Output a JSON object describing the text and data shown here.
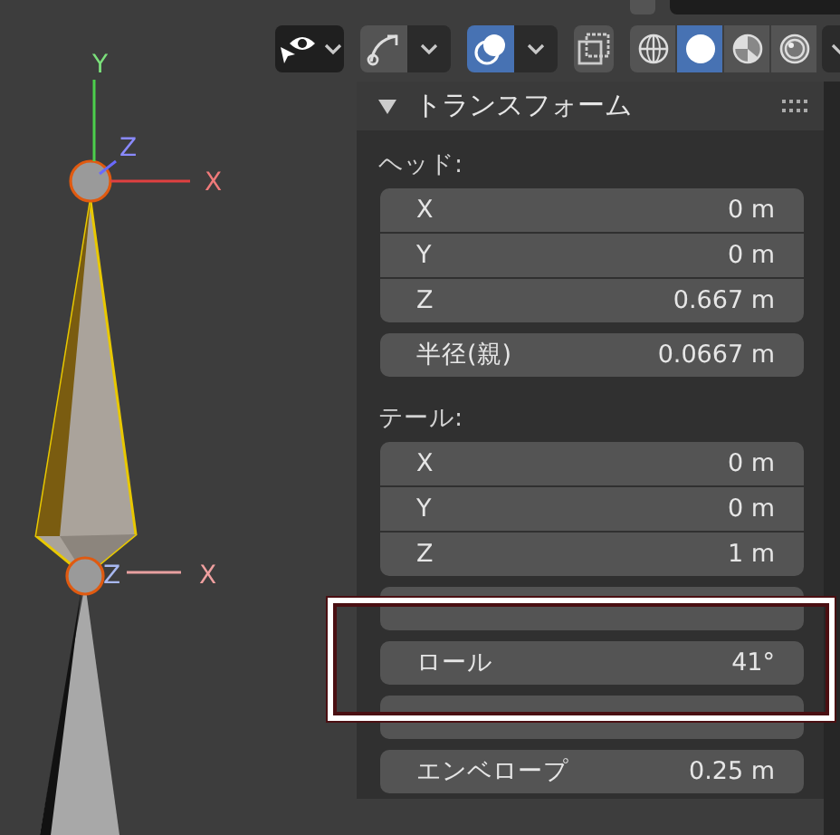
{
  "viewport": {
    "axes": [
      {
        "label": "Y",
        "kind": "y"
      },
      {
        "label": "Z",
        "kind": "z"
      },
      {
        "label": "X",
        "kind": "x"
      },
      {
        "label": "Z",
        "kind": "z2"
      },
      {
        "label": "X",
        "kind": "x2"
      }
    ]
  },
  "toolbar": {
    "toggles": [
      {
        "kind": "visibility",
        "on": false,
        "dropdown": true
      },
      {
        "kind": "bone",
        "on": false,
        "dropdown": true
      },
      {
        "kind": "overlay",
        "on": true,
        "dropdown": true
      },
      {
        "kind": "xray",
        "on": false,
        "dropdown": false
      }
    ],
    "shading": [
      {
        "kind": "wireframe",
        "selected": false
      },
      {
        "kind": "solid",
        "selected": true
      },
      {
        "kind": "material",
        "selected": false
      },
      {
        "kind": "rendered",
        "selected": false
      }
    ]
  },
  "panel": {
    "title": "トランスフォーム",
    "expanded": true,
    "sections": [
      {
        "label": "ヘッド:",
        "groups": [
          [
            {
              "label": "X",
              "value": "0 m"
            },
            {
              "label": "Y",
              "value": "0 m"
            },
            {
              "label": "Z",
              "value": "0.667 m"
            }
          ],
          [
            {
              "label": "半径(親)",
              "value": "0.0667 m"
            }
          ]
        ]
      },
      {
        "label": "テール:",
        "groups": [
          [
            {
              "label": "X",
              "value": "0 m"
            },
            {
              "label": "Y",
              "value": "0 m"
            },
            {
              "label": "Z",
              "value": "1 m"
            }
          ],
          [
            {
              "kind": "covered"
            }
          ],
          [
            {
              "label": "ロール",
              "value": "41°"
            }
          ],
          [
            {
              "kind": "covered"
            }
          ],
          [
            {
              "label": "エンベロープ",
              "value": "0.25 m"
            }
          ]
        ]
      }
    ]
  },
  "annotation": {
    "kind": "highlight"
  }
}
